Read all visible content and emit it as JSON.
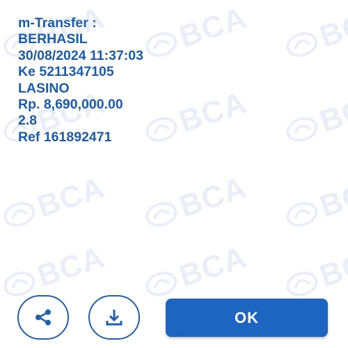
{
  "watermark": {
    "text": "BCA",
    "color": "#e9eef8",
    "icon": "bca-logo-icon"
  },
  "receipt": {
    "title": "m-Transfer :",
    "status": "BERHASIL",
    "datetime": "30/08/2024 11:37:03",
    "destination": "Ke 5211347105",
    "recipient": "LASINO",
    "amount": "Rp. 8,690,000.00",
    "note": "2.8",
    "reference": "Ref 161892471"
  },
  "actions": {
    "share_icon": "share-icon",
    "download_icon": "download-icon",
    "ok_label": "OK"
  },
  "colors": {
    "text": "#1a5ca8",
    "button": "#1d65c0",
    "outline": "#1f5fae"
  }
}
